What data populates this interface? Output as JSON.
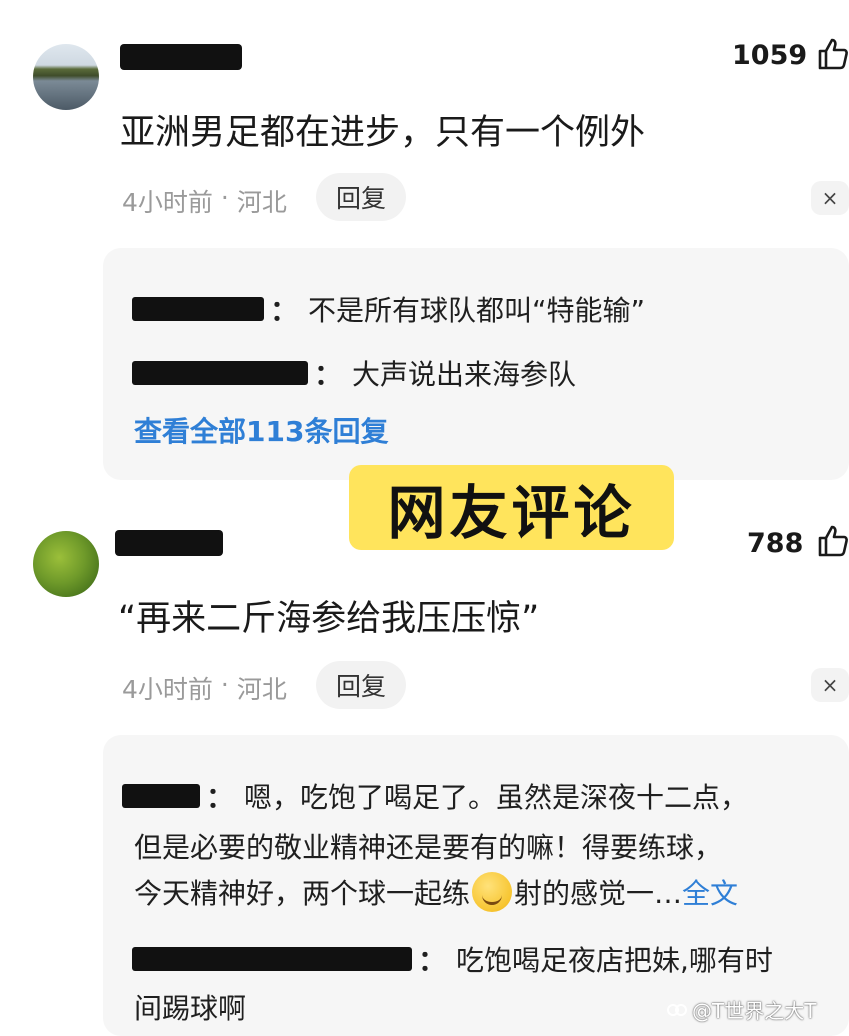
{
  "comments": [
    {
      "likes": "1059",
      "text": "亚洲男足都在进步，只有一个例外",
      "time": "4小时前",
      "dot": "·",
      "location": "河北",
      "reply_label": "回复",
      "close": "×",
      "replies": [
        {
          "text": "不是所有球队都叫“特能输”"
        },
        {
          "text": "大声说出来海参队"
        }
      ],
      "view_all": "查看全部113条回复"
    },
    {
      "likes": "788",
      "text": "“再来二斤海参给我压压惊”",
      "time": "4小时前",
      "dot": "·",
      "location": "河北",
      "reply_label": "回复",
      "close": "×",
      "replies": [
        {
          "line1": "嗯，吃饱了喝足了。虽然是深夜十二点，",
          "line2": "但是必要的敬业精神还是要有的嘛！得要练球，",
          "line3a": "今天精神好，两个球一起练",
          "line3b": "射的感觉一…",
          "full_text": "全文"
        },
        {
          "line1": "吃饱喝足夜店把妹,哪有时",
          "line2": "间踢球啊"
        }
      ]
    }
  ],
  "banner": "网友评论",
  "colon": "：",
  "watermark": "@T世界之大T",
  "icons": {
    "like": "thumbs-up-icon",
    "close": "close-icon",
    "emoji": "smirk-emoji-icon",
    "watermark": "app-logo-icon"
  }
}
